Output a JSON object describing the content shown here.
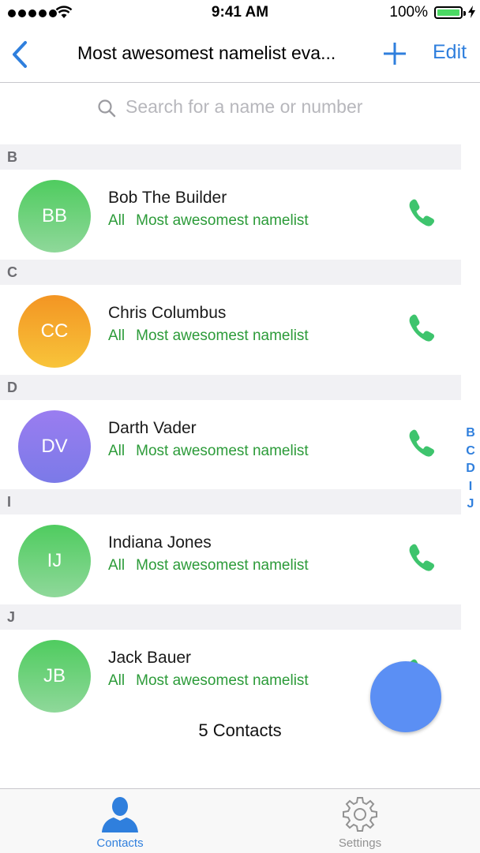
{
  "status_bar": {
    "time": "9:41 AM",
    "battery": "100%"
  },
  "nav": {
    "title": "Most awesomest namelist eva...",
    "edit_label": "Edit"
  },
  "search": {
    "placeholder": "Search for a name or number"
  },
  "sections": [
    {
      "letter": "B",
      "contact": {
        "initials": "BB",
        "name": "Bob The Builder",
        "groups": [
          "All",
          "Most awesomest namelist"
        ],
        "color": "#5fcf6c"
      }
    },
    {
      "letter": "C",
      "contact": {
        "initials": "CC",
        "name": "Chris Columbus",
        "groups": [
          "All",
          "Most awesomest namelist"
        ],
        "color": "#f6a623"
      }
    },
    {
      "letter": "D",
      "contact": {
        "initials": "DV",
        "name": "Darth Vader",
        "groups": [
          "All",
          "Most awesomest namelist"
        ],
        "color": "#8e7bf0"
      }
    },
    {
      "letter": "I",
      "contact": {
        "initials": "IJ",
        "name": "Indiana Jones",
        "groups": [
          "All",
          "Most awesomest namelist"
        ],
        "color": "#5fcf6c"
      }
    },
    {
      "letter": "J",
      "contact": {
        "initials": "JB",
        "name": "Jack Bauer",
        "groups": [
          "All",
          "Most awesomest namelist"
        ],
        "color": "#5fcf6c"
      }
    }
  ],
  "index_letters": [
    "B",
    "C",
    "D",
    "I",
    "J"
  ],
  "footer": {
    "count_text": "5 Contacts"
  },
  "tabs": [
    {
      "label": "Contacts",
      "icon": "person-icon",
      "active": true
    },
    {
      "label": "Settings",
      "icon": "gear-icon",
      "active": false
    }
  ],
  "colors": {
    "accent": "#2f7fdd",
    "group_text": "#2c9b39",
    "phone": "#3ec46d",
    "fab": "#5b8ff4"
  }
}
